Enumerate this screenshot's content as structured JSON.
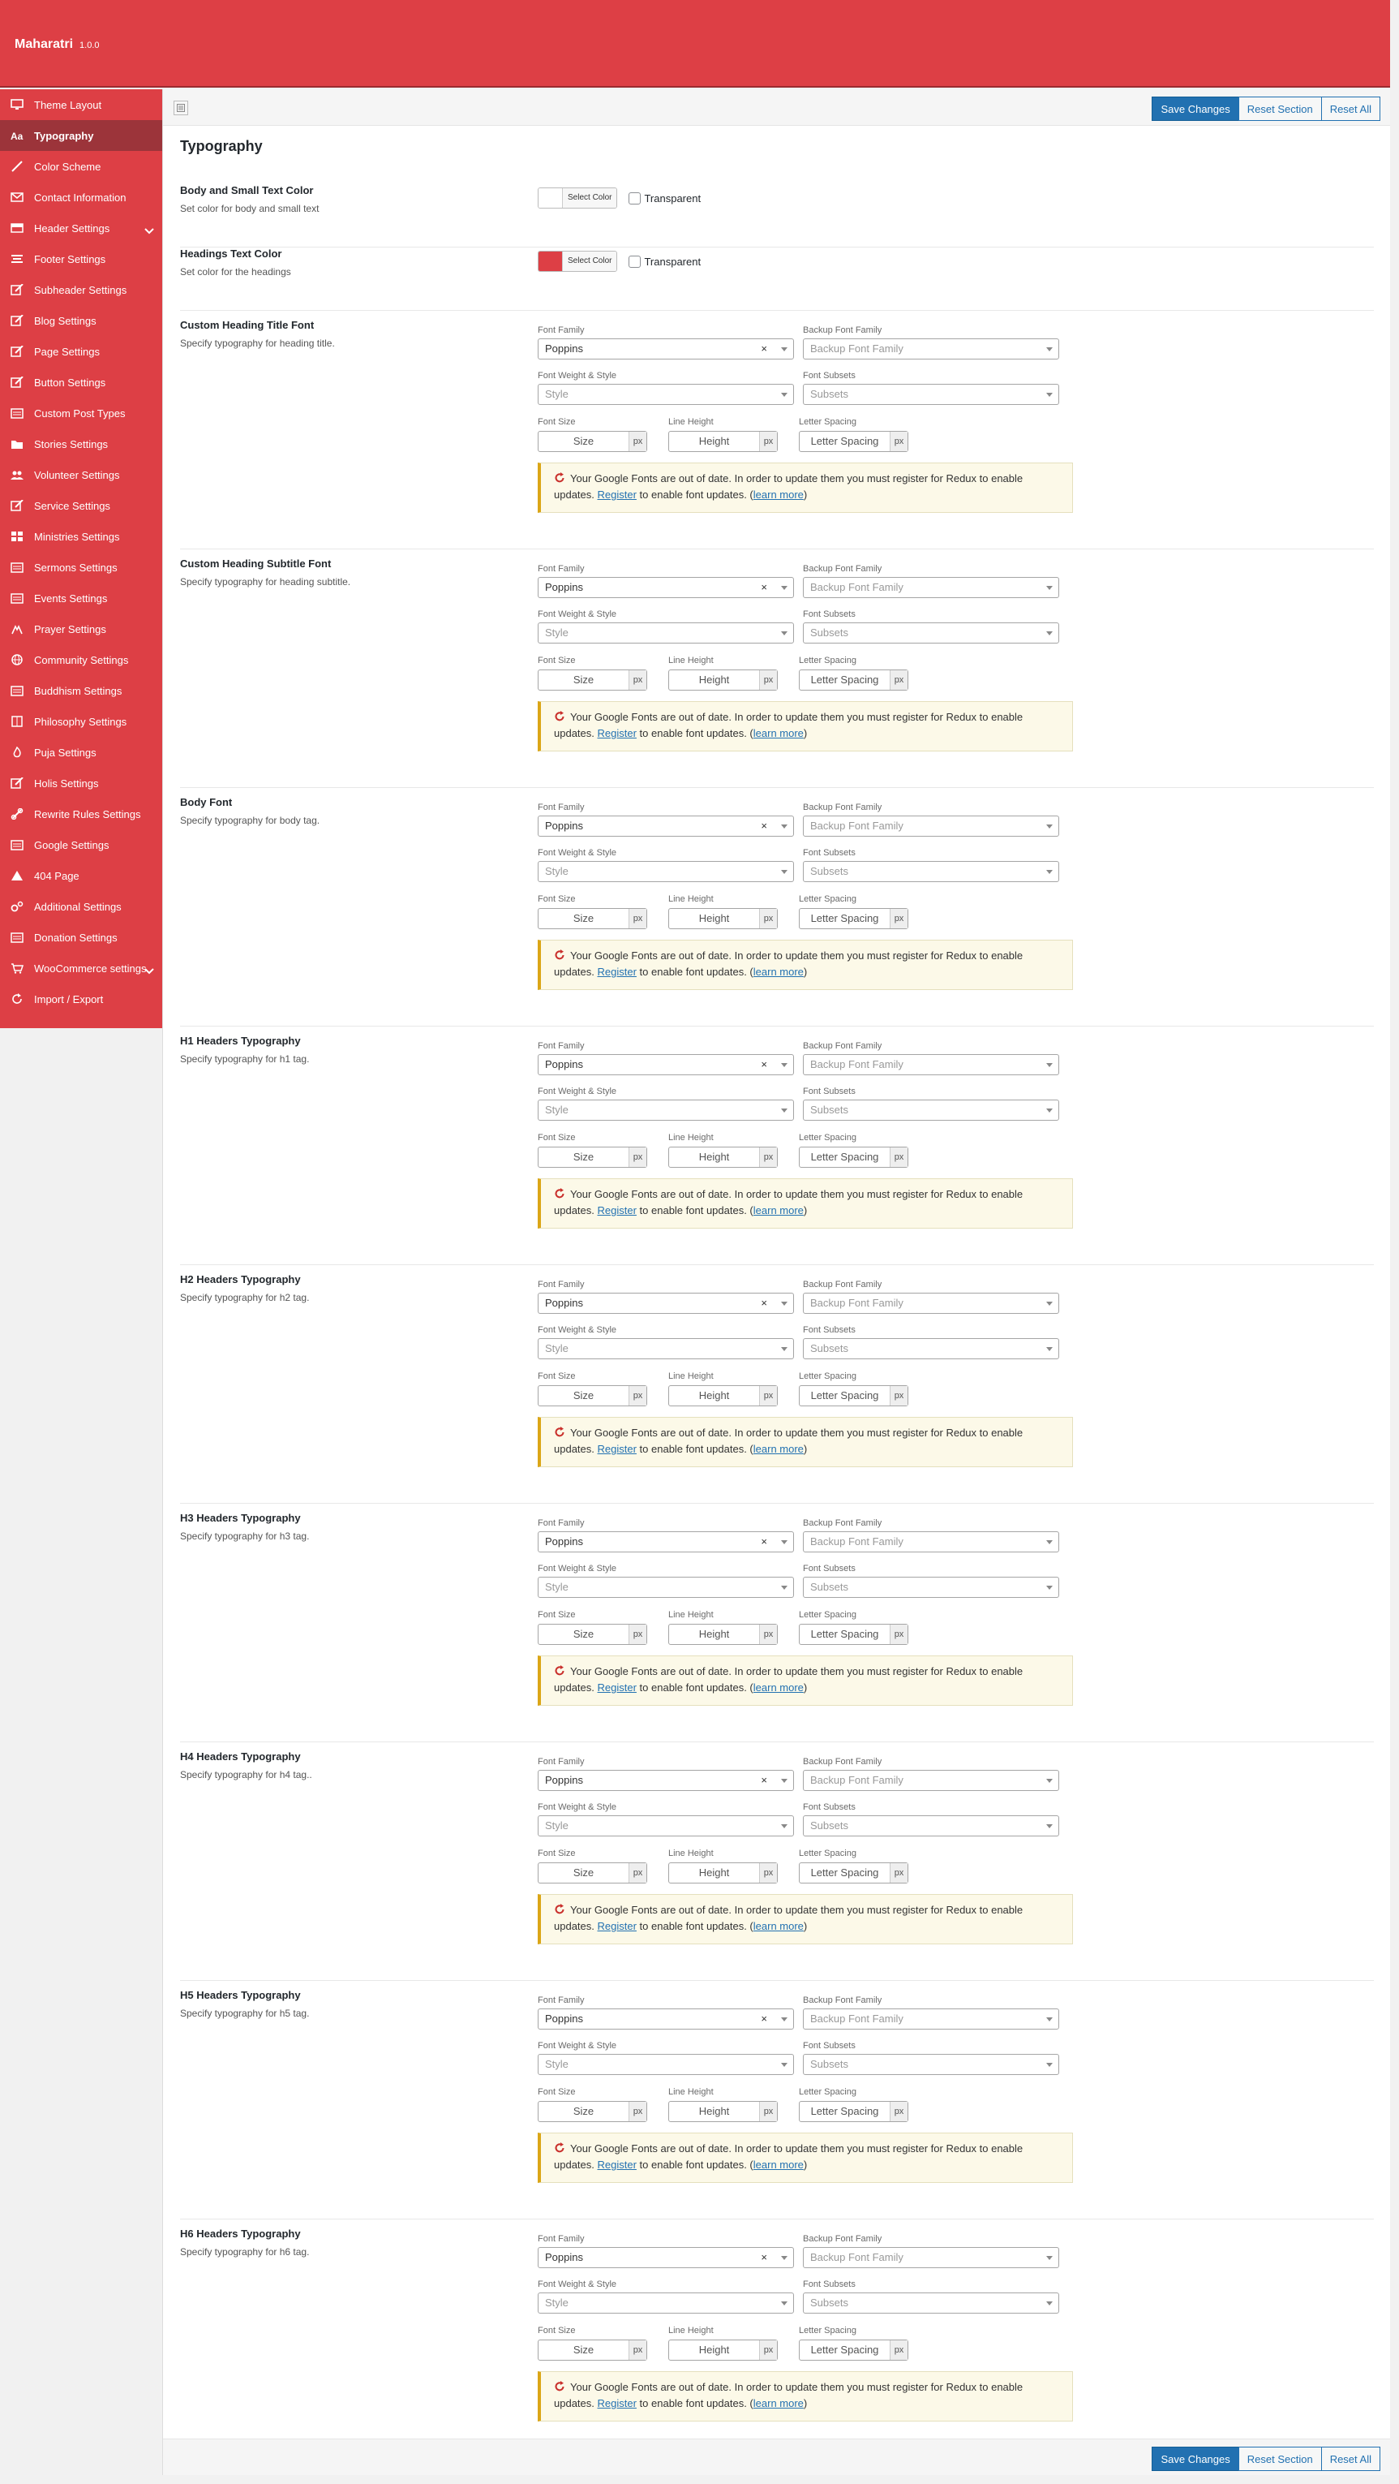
{
  "header": {
    "title": "Maharatri",
    "version": "1.0.0"
  },
  "sidebar": {
    "items": [
      {
        "label": "Theme Layout",
        "icon": "monitor-icon"
      },
      {
        "label": "Typography",
        "icon": "typography-icon",
        "active": true
      },
      {
        "label": "Color Scheme",
        "icon": "brush-icon"
      },
      {
        "label": "Contact Information",
        "icon": "envelope-icon"
      },
      {
        "label": "Header Settings",
        "icon": "header-icon",
        "expandable": true
      },
      {
        "label": "Footer Settings",
        "icon": "footer-icon"
      },
      {
        "label": "Subheader Settings",
        "icon": "edit-icon"
      },
      {
        "label": "Blog Settings",
        "icon": "edit-icon"
      },
      {
        "label": "Page Settings",
        "icon": "edit-icon"
      },
      {
        "label": "Button Settings",
        "icon": "edit-icon"
      },
      {
        "label": "Custom Post Types",
        "icon": "list-icon"
      },
      {
        "label": "Stories Settings",
        "icon": "folder-icon"
      },
      {
        "label": "Volunteer Settings",
        "icon": "group-icon"
      },
      {
        "label": "Service Settings",
        "icon": "edit-icon"
      },
      {
        "label": "Ministries Settings",
        "icon": "grid-icon"
      },
      {
        "label": "Sermons Settings",
        "icon": "list-icon"
      },
      {
        "label": "Events Settings",
        "icon": "list-icon"
      },
      {
        "label": "Prayer Settings",
        "icon": "hands-icon"
      },
      {
        "label": "Community Settings",
        "icon": "globe-icon"
      },
      {
        "label": "Buddhism Settings",
        "icon": "list-icon"
      },
      {
        "label": "Philosophy Settings",
        "icon": "book-icon"
      },
      {
        "label": "Puja Settings",
        "icon": "flame-icon"
      },
      {
        "label": "Holis Settings",
        "icon": "edit-icon"
      },
      {
        "label": "Rewrite Rules Settings",
        "icon": "link-icon"
      },
      {
        "label": "Google Settings",
        "icon": "list-icon"
      },
      {
        "label": "404 Page",
        "icon": "warning-icon"
      },
      {
        "label": "Additional Settings",
        "icon": "gears-icon"
      },
      {
        "label": "Donation Settings",
        "icon": "list-icon"
      },
      {
        "label": "WooCommerce settings",
        "icon": "cart-icon",
        "expandable": true
      },
      {
        "label": "Import / Export",
        "icon": "refresh-icon"
      }
    ]
  },
  "toolbar": {
    "save": "Save Changes",
    "reset_section": "Reset Section",
    "reset_all": "Reset All"
  },
  "section": {
    "title": "Typography"
  },
  "colors": {
    "accent": "#dd3f45",
    "sidebar_active": "#9c343a",
    "primary_button": "#2271b1",
    "notice_border": "#dba617"
  },
  "color_fields": [
    {
      "title": "Body and Small Text Color",
      "desc": "Set color for body and small text",
      "swatch": "#ffffff",
      "button": "Select Color",
      "transparent": "Transparent"
    },
    {
      "title": "Headings Text Color",
      "desc": "Set color for the headings",
      "swatch": "#dd3f45",
      "button": "Select Color",
      "transparent": "Transparent"
    }
  ],
  "labels": {
    "font_family": "Font Family",
    "backup_font_family": "Backup Font Family",
    "font_weight_style": "Font Weight & Style",
    "font_subsets": "Font Subsets",
    "font_size": "Font Size",
    "line_height": "Line Height",
    "letter_spacing": "Letter Spacing"
  },
  "placeholders": {
    "backup": "Backup Font Family",
    "style": "Style",
    "subsets": "Subsets",
    "size": "Size",
    "height": "Height",
    "letter_spacing": "Letter Spacing",
    "unit": "px",
    "clear": "×"
  },
  "notice": {
    "before": "Your Google Fonts are out of date. In order to update them you must register for Redux to enable updates.",
    "register": "Register",
    "middle": "to enable font updates. (",
    "learn_more": "learn more",
    "after": ")"
  },
  "typography_fields": [
    {
      "title": "Custom Heading Title Font",
      "desc": "Specify typography for heading title.",
      "font": "Poppins"
    },
    {
      "title": "Custom Heading Subtitle Font",
      "desc": "Specify typography for heading subtitle.",
      "font": "Poppins"
    },
    {
      "title": "Body Font",
      "desc": "Specify typography for body tag.",
      "font": "Poppins"
    },
    {
      "title": "H1 Headers Typography",
      "desc": "Specify typography for h1 tag.",
      "font": "Poppins"
    },
    {
      "title": "H2 Headers Typography",
      "desc": "Specify typography for h2 tag.",
      "font": "Poppins"
    },
    {
      "title": "H3 Headers Typography",
      "desc": "Specify typography for h3 tag.",
      "font": "Poppins"
    },
    {
      "title": "H4 Headers Typography",
      "desc": "Specify typography for h4 tag..",
      "font": "Poppins"
    },
    {
      "title": "H5 Headers Typography",
      "desc": "Specify typography for h5 tag.",
      "font": "Poppins"
    },
    {
      "title": "H6 Headers Typography",
      "desc": "Specify typography for h6 tag.",
      "font": "Poppins"
    }
  ]
}
